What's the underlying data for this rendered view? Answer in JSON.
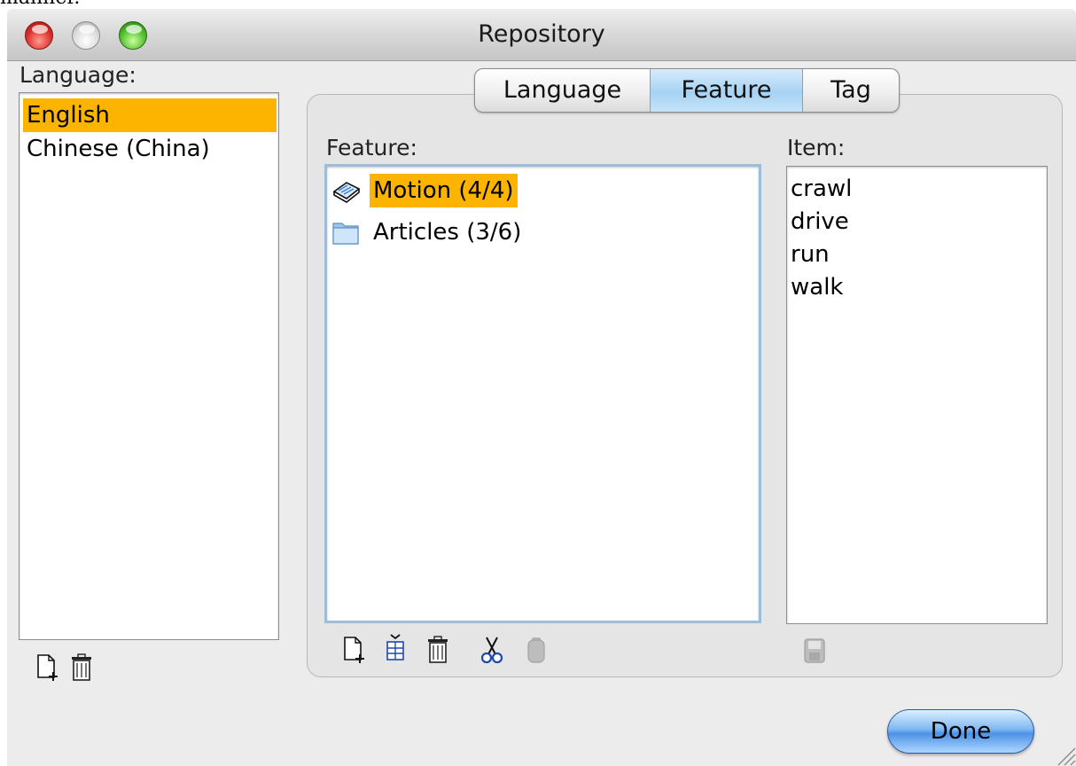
{
  "page_fragment": "manner.",
  "window": {
    "title": "Repository"
  },
  "languages_panel": {
    "label": "Language:",
    "items": [
      {
        "label": "English",
        "selected": true
      },
      {
        "label": "Chinese (China)",
        "selected": false
      }
    ],
    "toolbar": [
      "new-document-icon",
      "trash-icon"
    ]
  },
  "tabs": [
    {
      "label": "Language",
      "selected": false
    },
    {
      "label": "Feature",
      "selected": true
    },
    {
      "label": "Tag",
      "selected": false
    }
  ],
  "feature_panel": {
    "label": "Feature:",
    "items": [
      {
        "label": "Motion (4/4)",
        "icon": "book-icon",
        "selected": true
      },
      {
        "label": "Articles (3/6)",
        "icon": "folder-icon",
        "selected": false
      }
    ],
    "toolbar": [
      "new-document-icon",
      "insert-column-icon",
      "trash-icon",
      "cut-icon",
      "paste-icon"
    ]
  },
  "item_panel": {
    "label": "Item:",
    "items": [
      "crawl",
      "drive",
      "run",
      "walk"
    ],
    "toolbar": [
      "save-icon"
    ]
  },
  "buttons": {
    "done": "Done"
  },
  "colors": {
    "selection": "#fdb400",
    "focus_ring": "#9cbedb",
    "accent": "#4c92e6"
  }
}
